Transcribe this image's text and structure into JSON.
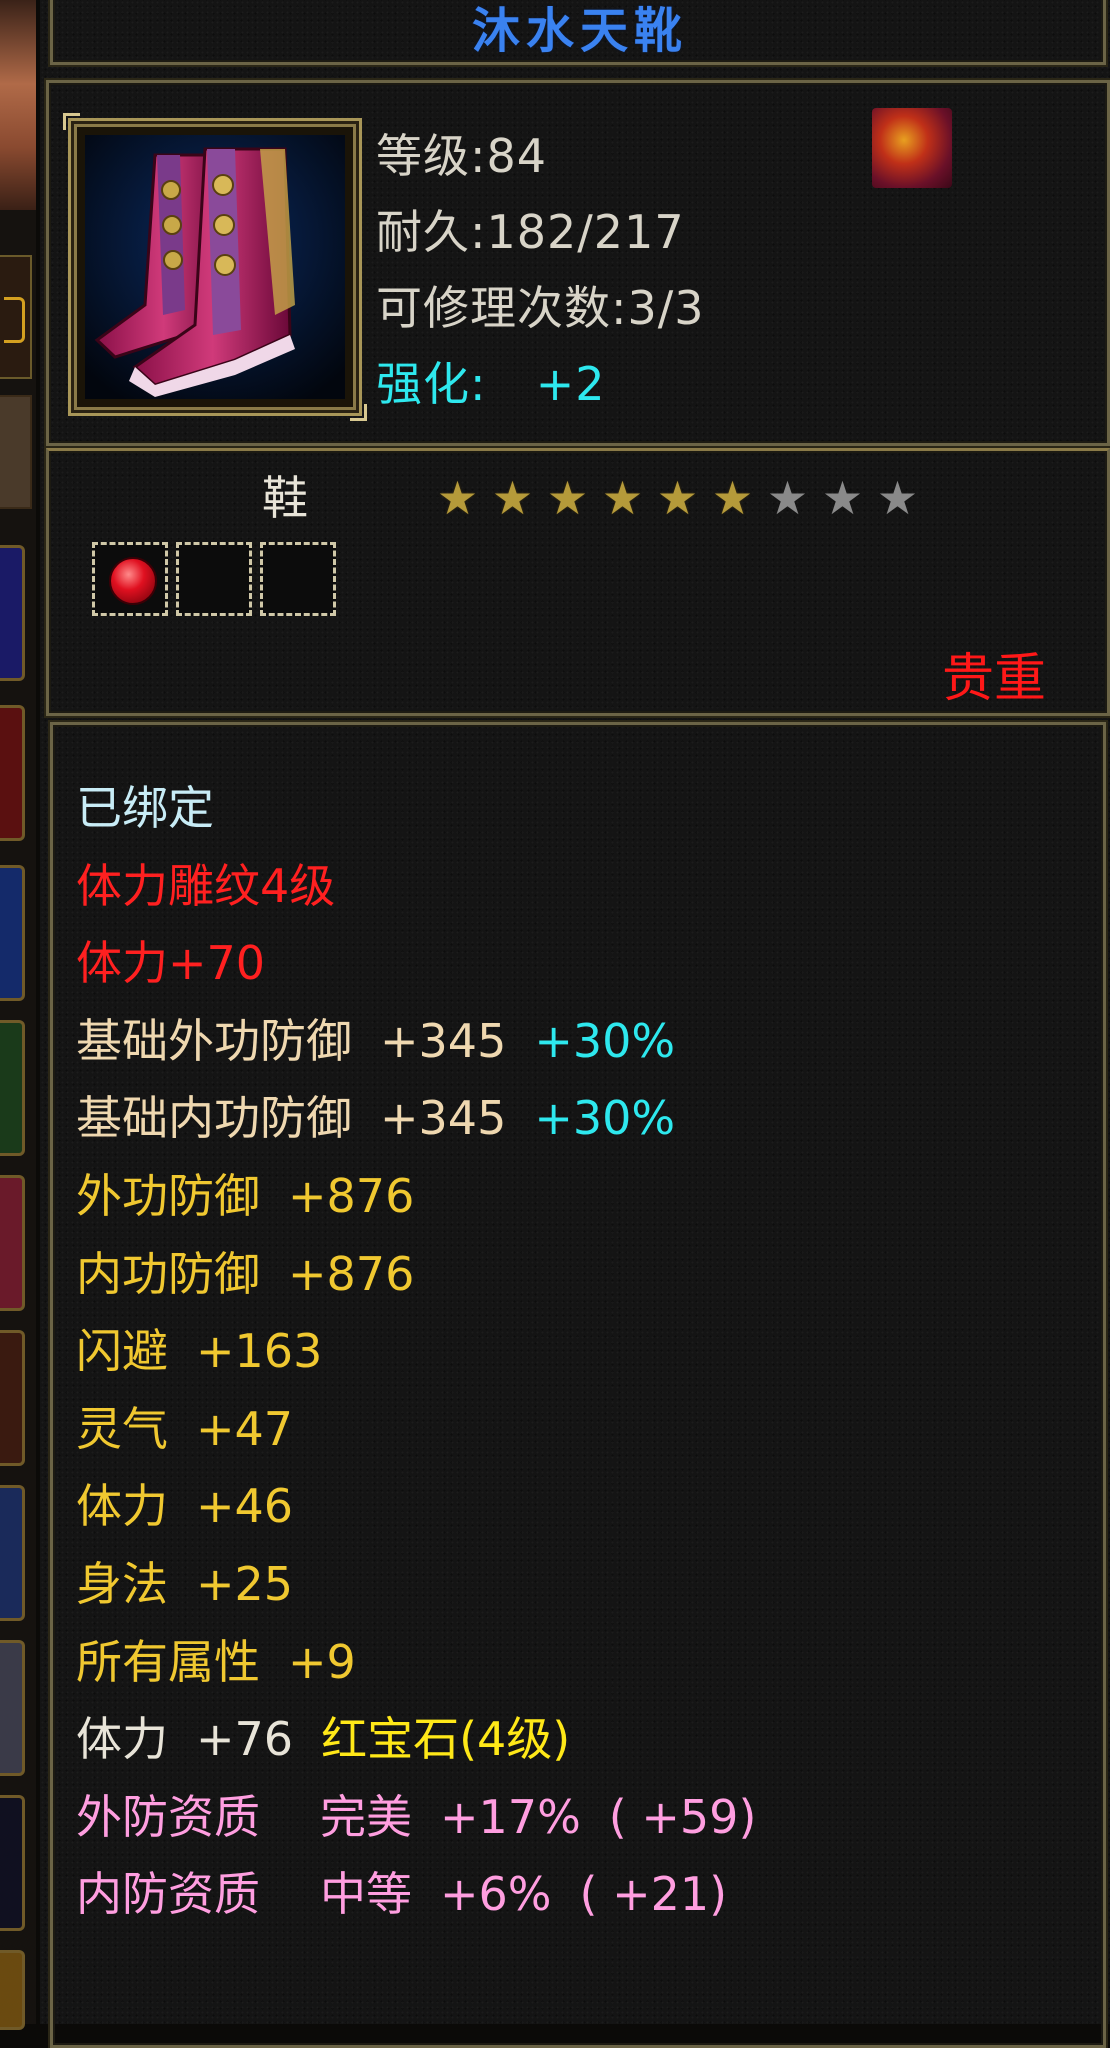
{
  "item": {
    "name": "沐水天靴",
    "level": "等级:84",
    "durability": "耐久:182/217",
    "repair_count": "可修理次数:3/3",
    "enhance_label": "强化:",
    "enhance_value": "+2",
    "type": "鞋",
    "stars_filled": 6,
    "stars_total": 9,
    "sockets": [
      {
        "filled": true,
        "gem_color": "#e01020",
        "icon": "ruby-gem-icon"
      },
      {
        "filled": false
      },
      {
        "filled": false
      }
    ],
    "rarity": "贵重",
    "badge_icon": "phoenix-badge-icon"
  },
  "attributes": {
    "bound": "已绑定",
    "engraving": "体力雕纹4级",
    "engraving_bonus": "体力+70",
    "base_outer_def": {
      "label": "基础外功防御",
      "value": "+345",
      "pct": "+30%"
    },
    "base_inner_def": {
      "label": "基础内功防御",
      "value": "+345",
      "pct": "+30%"
    },
    "outer_def": {
      "label": "外功防御",
      "value": "+876"
    },
    "inner_def": {
      "label": "内功防御",
      "value": "+876"
    },
    "dodge": {
      "label": "闪避",
      "value": "+163"
    },
    "spirit": {
      "label": "灵气",
      "value": "+47"
    },
    "vitality": {
      "label": "体力",
      "value": "+46"
    },
    "agility": {
      "label": "身法",
      "value": "+25"
    },
    "all_attr": {
      "label": "所有属性",
      "value": "+9"
    },
    "gem_bonus": {
      "label": "体力",
      "value": "+76",
      "gem": "红宝石(4级)"
    },
    "outer_quality": {
      "label": "外防资质",
      "grade": "完美",
      "pct": "+17%",
      "bonus": "( +59)"
    },
    "inner_quality": {
      "label": "内防资质",
      "grade": "中等",
      "pct": "+6%",
      "bonus": "( +21)"
    }
  },
  "colors": {
    "title": "#3a82f0",
    "enhance": "#2ee8ee",
    "rarity": "#ff1818",
    "engraving": "#ff2020",
    "bonus_pct": "#2ee8ee",
    "stat_gold": "#f0c830",
    "quality_pink": "#ff9ee0"
  }
}
